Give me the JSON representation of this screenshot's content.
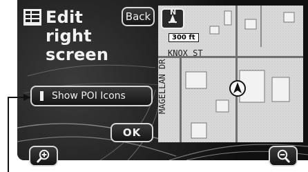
{
  "screen": {
    "title_lines": [
      "Edit",
      "right",
      "screen"
    ],
    "back_label": "Back",
    "poi_label": "Show POI Icons",
    "ok_label": "OK"
  },
  "map": {
    "scale_label": "300 ft",
    "north_label": "N",
    "street_horizontal": "KNOX ST",
    "street_vertical": "MAGELLAN DR"
  },
  "icons": {
    "menu": "list-icon",
    "zoom_in": "zoom-in-icon",
    "zoom_out": "zoom-out-icon",
    "vehicle": "vehicle-position-icon",
    "north_arrow": "north-arrow-icon"
  },
  "colors": {
    "screen_bg": "#161616",
    "button_border": "#d8d8d8",
    "map_bg": "#d9d9d9",
    "building": "#f2f2f2",
    "road": "#777777"
  }
}
